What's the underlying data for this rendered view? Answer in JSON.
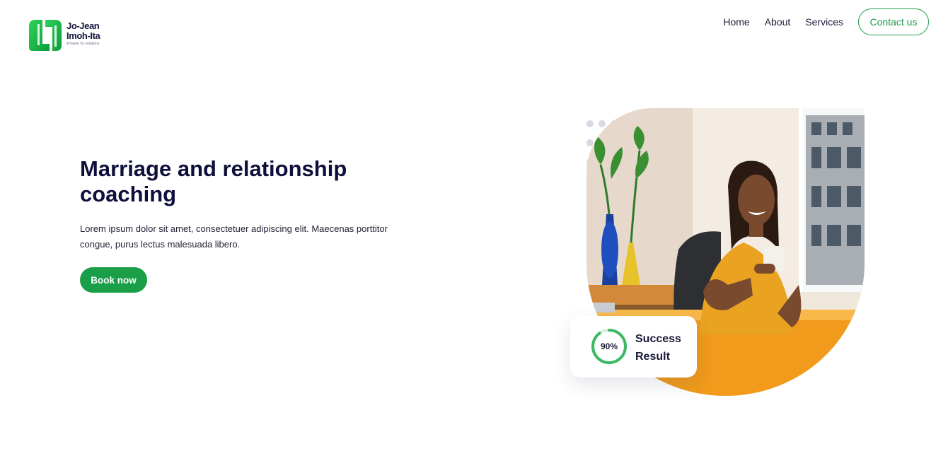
{
  "brand": {
    "name": "Jo-Jean\nImoh-Ita",
    "tagline": "A haven for solutions",
    "logo_icon": "jj-monogram-icon",
    "color": "#1fa04a"
  },
  "nav": {
    "links": [
      {
        "label": "Home"
      },
      {
        "label": "About"
      },
      {
        "label": "Services"
      }
    ],
    "contact_label": "Contact us"
  },
  "hero": {
    "title": "Marriage and relationship coaching",
    "description": "Lorem ipsum dolor sit amet, consectetuer adipiscing elit. Maecenas porttitor congue, purus lectus malesuada libero.",
    "cta_label": "Book now"
  },
  "stat": {
    "percent_label": "90%",
    "percent": 90,
    "line1": "Success",
    "line2": "Result"
  },
  "colors": {
    "accent": "#1fa04a",
    "heading": "#0f0f3c",
    "photo_top": "#d9d3c8",
    "desk": "#f5a81a"
  }
}
